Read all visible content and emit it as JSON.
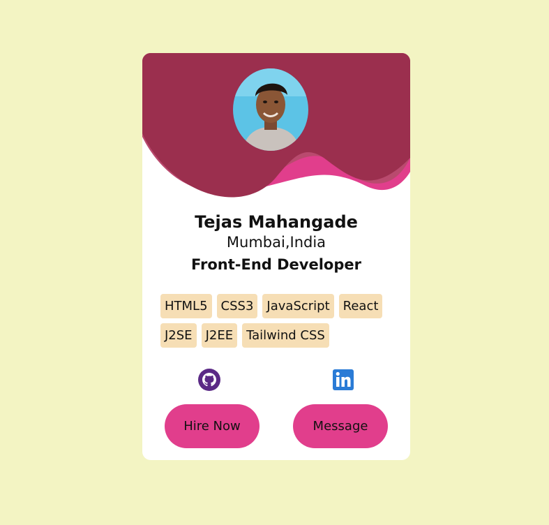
{
  "profile": {
    "name": "Tejas Mahangade",
    "location": "Mumbai,India",
    "role": "Front-End Developer"
  },
  "skills": {
    "row1": [
      "HTML5",
      "CSS3",
      "JavaScript",
      "React"
    ],
    "row2": [
      "J2SE",
      "J2EE",
      "Tailwind CSS"
    ]
  },
  "social": {
    "github_icon": "github-icon",
    "linkedin_icon": "linkedin-icon"
  },
  "actions": {
    "hire_label": "Hire Now",
    "message_label": "Message"
  },
  "colors": {
    "background": "#f3f4c3",
    "wave_dark": "#9b2f4e",
    "wave_pink": "#e13e8c",
    "wave_mid": "#b94a6e",
    "button": "#e13e8c",
    "skill_chip": "#f6deb5",
    "github": "#5b2a86",
    "linkedin": "#2a7bd6"
  }
}
